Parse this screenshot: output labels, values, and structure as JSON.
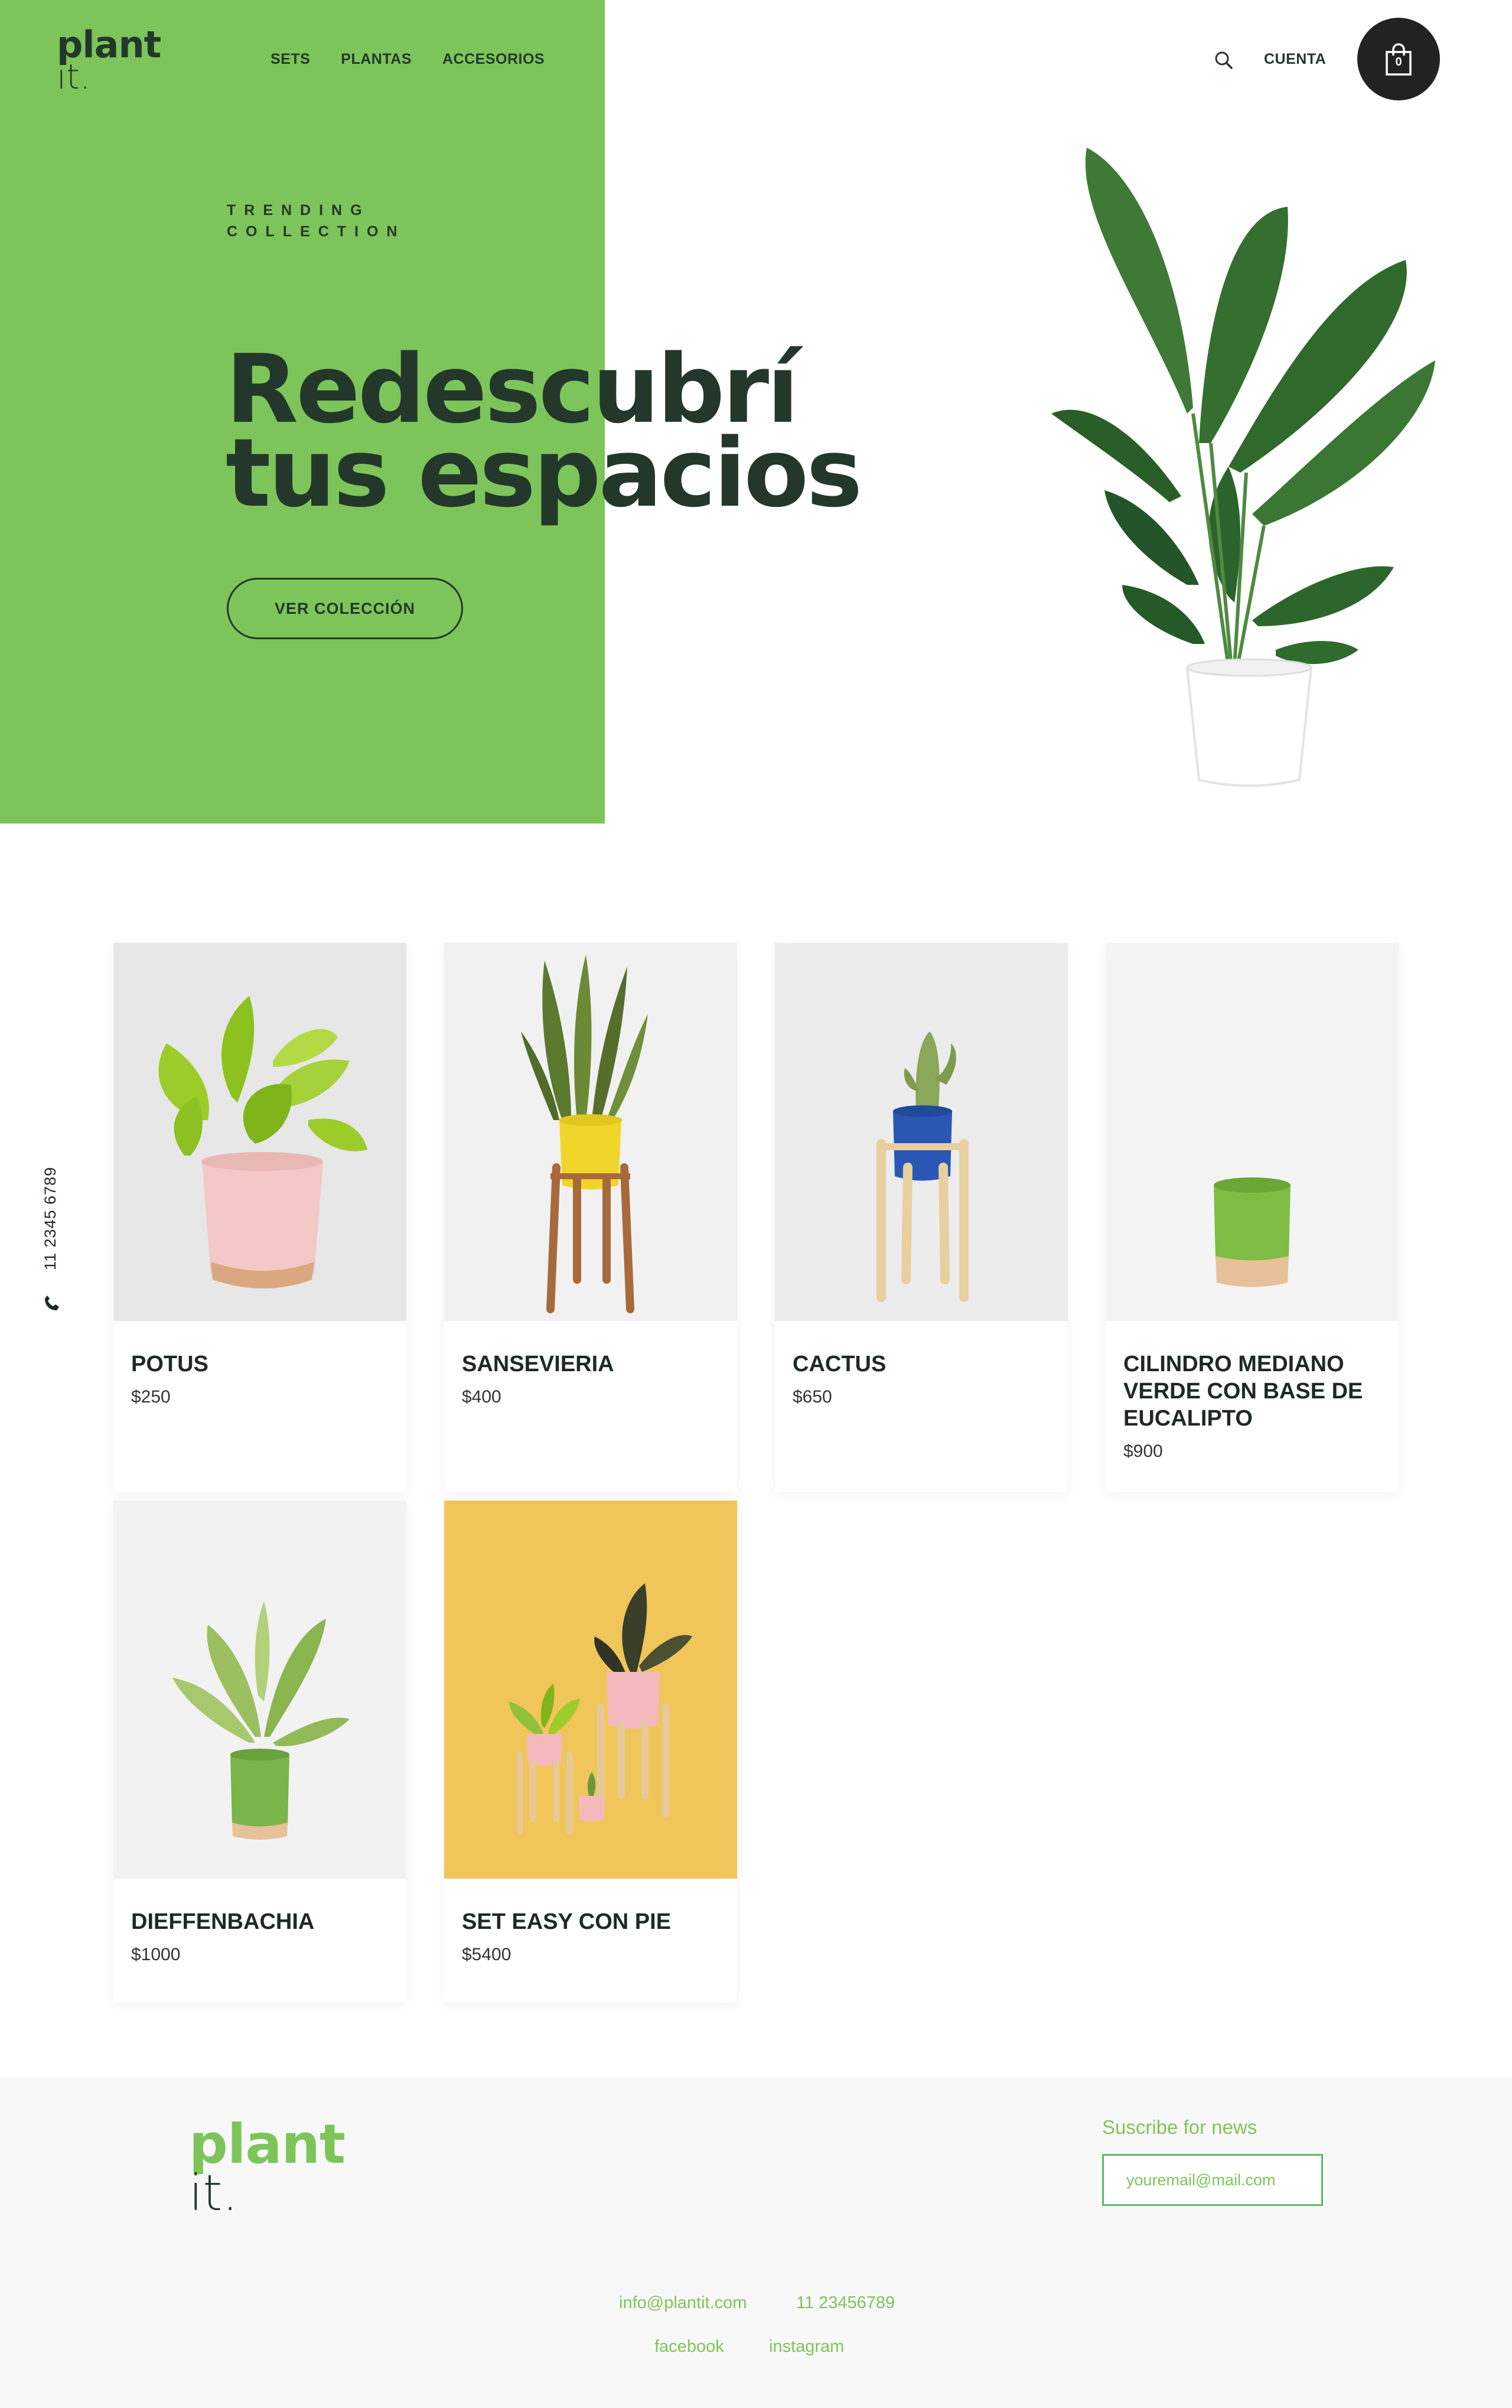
{
  "brand": {
    "line1": "plant",
    "line2": "it."
  },
  "nav": [
    "SETS",
    "PLANTAS",
    "ACCESORIOS"
  ],
  "header": {
    "account_label": "CUENTA",
    "cart_count": "0"
  },
  "hero": {
    "eyebrow_line1": "TRENDING",
    "eyebrow_line2": "COLLECTION",
    "title_line1": "Redescubrí",
    "title_line2": "tus espacios",
    "cta_label": "VER COLECCIÓN"
  },
  "side_contact": {
    "phone": "11 2345 6789"
  },
  "products": [
    {
      "name": "POTUS",
      "price": "$250"
    },
    {
      "name": "SANSEVIERIA",
      "price": "$400"
    },
    {
      "name": "CACTUS",
      "price": "$650"
    },
    {
      "name": "CILINDRO MEDIANO VERDE CON BASE DE EUCALIPTO",
      "price": "$900"
    },
    {
      "name": "DIEFFENBACHIA",
      "price": "$1000"
    },
    {
      "name": "SET EASY CON PIE",
      "price": "$5400"
    }
  ],
  "footer": {
    "logo_line1": "plant",
    "logo_line2": "it.",
    "subscribe_label": "Suscribe for news",
    "email_placeholder": "youremail@mail.com",
    "email": "info@plantit.com",
    "phone": "11 23456789",
    "facebook": "facebook",
    "instagram": "instagram"
  },
  "colors": {
    "brand_green": "#7dc55a",
    "dark_text": "#23382a",
    "cart_bg": "#222222",
    "footer_bg": "#f8f8f8"
  }
}
